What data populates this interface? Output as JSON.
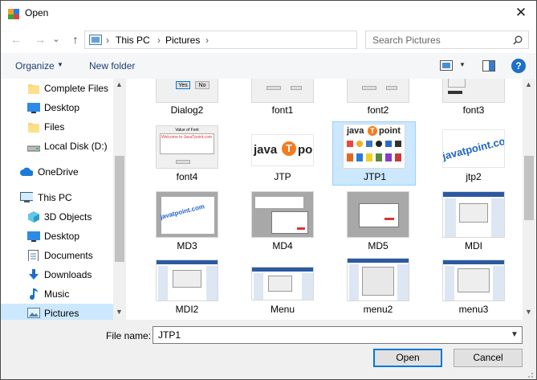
{
  "window": {
    "title": "Open",
    "close_glyph": "✕"
  },
  "nav": {
    "back_glyph": "←",
    "forward_glyph": "→",
    "chevron_glyph": "⌄",
    "up_glyph": "↑",
    "breadcrumb": [
      "This PC",
      "Pictures"
    ],
    "separator_glyph": "›",
    "search_placeholder": "Search Pictures"
  },
  "toolbar": {
    "organize_label": "Organize",
    "new_folder_label": "New folder",
    "help_glyph": "?"
  },
  "sidebar": {
    "items": [
      {
        "label": "Complete Files",
        "icon": "folder-icon"
      },
      {
        "label": "Desktop",
        "icon": "desktop-icon"
      },
      {
        "label": "Files",
        "icon": "folder-icon"
      },
      {
        "label": "Local Disk (D:)",
        "icon": "drive-icon"
      },
      {
        "label": "OneDrive",
        "icon": "cloud-icon"
      },
      {
        "label": "This PC",
        "icon": "computer-icon"
      },
      {
        "label": "3D Objects",
        "icon": "cube-icon"
      },
      {
        "label": "Desktop",
        "icon": "desktop-icon"
      },
      {
        "label": "Documents",
        "icon": "documents-icon"
      },
      {
        "label": "Downloads",
        "icon": "download-icon"
      },
      {
        "label": "Music",
        "icon": "music-icon"
      },
      {
        "label": "Pictures",
        "icon": "pictures-icon"
      }
    ],
    "selected": "Pictures"
  },
  "files": [
    {
      "name": "Dialog2"
    },
    {
      "name": "font1"
    },
    {
      "name": "font2"
    },
    {
      "name": "font3"
    },
    {
      "name": "font4"
    },
    {
      "name": "JTP"
    },
    {
      "name": "JTP1",
      "selected": true
    },
    {
      "name": "jtp2"
    },
    {
      "name": "MD3"
    },
    {
      "name": "MD4"
    },
    {
      "name": "MD5"
    },
    {
      "name": "MDI"
    },
    {
      "name": "MDI2"
    },
    {
      "name": "Menu"
    },
    {
      "name": "menu2"
    },
    {
      "name": "menu3"
    }
  ],
  "thumb_text": {
    "javatpoint": "javatpoint.com",
    "jtp_logo_left": "java",
    "jtp_logo_right": "point",
    "font4_header": "Value of Font",
    "font4_body": "Welcome to JavaTpoint.com",
    "dialog_yes": "Yes",
    "dialog_no": "No"
  },
  "bottom": {
    "file_name_label": "File name:",
    "file_name_value": "JTP1",
    "open_label": "Open",
    "cancel_label": "Cancel"
  },
  "colors": {
    "selection": "#cce8ff",
    "accent": "#0078d7",
    "javatpoint_blue": "#1e64c8",
    "logo_orange": "#f47b20"
  }
}
